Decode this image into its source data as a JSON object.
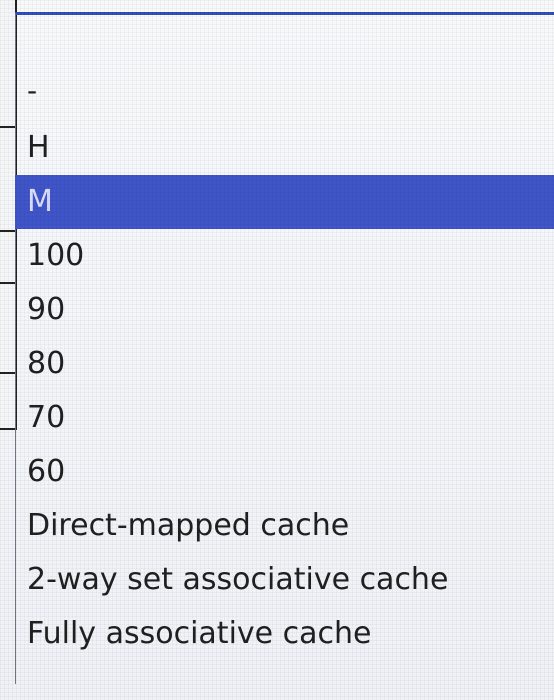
{
  "dropdown": {
    "selected_index": 2,
    "options": [
      "-",
      "H",
      "M",
      "100",
      "90",
      "80",
      "70",
      "60",
      "Direct-mapped cache",
      "2-way set associative cache",
      "Fully associative cache"
    ]
  },
  "colors": {
    "selected_background": "#3f55c8",
    "selected_text": "#d9ddf8",
    "text": "#202020",
    "border": "#2f4fb9"
  }
}
